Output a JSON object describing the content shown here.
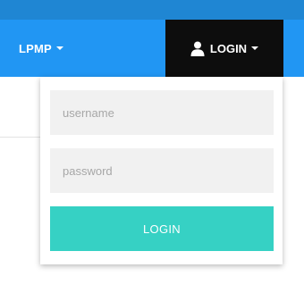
{
  "navbar": {
    "brand_label": "LPMP",
    "login_label": "LOGIN",
    "icons": {
      "user": "user-icon",
      "caret": "caret-down-icon"
    }
  },
  "login_form": {
    "username_placeholder": "username",
    "password_placeholder": "password",
    "submit_label": "LOGIN"
  },
  "colors": {
    "top_strip": "#1f86d3",
    "navbar": "#2196f3",
    "login_tab": "#0d0d0d",
    "field_bg": "#f1f1f1",
    "submit_button": "#36d1c4"
  }
}
